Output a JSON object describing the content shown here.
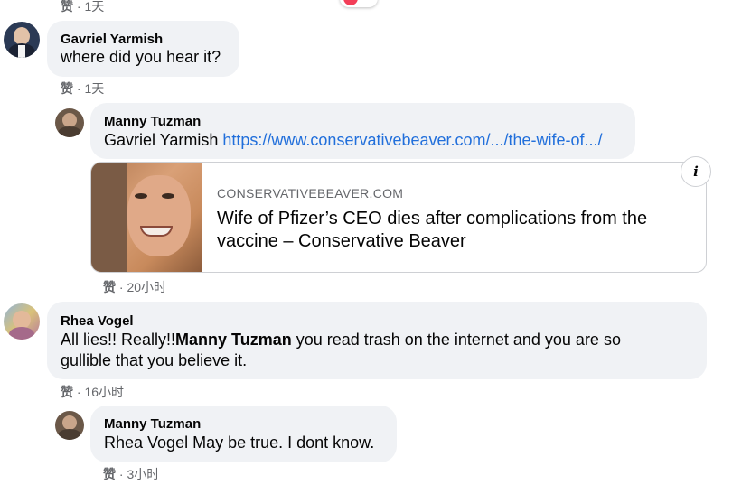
{
  "top": {
    "like_label": "赞",
    "time": "1天"
  },
  "comments": [
    {
      "author": "Gavriel Yarmish",
      "text": "where did you hear it?",
      "like_label": "赞",
      "time": "1天"
    },
    {
      "author": "Manny Tuzman",
      "mention": "Gavriel Yarmish",
      "link_text": "https://www.conservativebeaver.com/.../the-wife-of.../",
      "like_label": "赞",
      "time": "20小时",
      "preview": {
        "domain": "CONSERVATIVEBEAVER.COM",
        "title": "Wife of Pfizer’s CEO dies after complications from the vaccine – Conservative Beaver",
        "info_icon": "i"
      }
    },
    {
      "author": "Rhea Vogel",
      "text_before": "All lies!! Really!!",
      "mention": "Manny Tuzman",
      "text_after_line1": " you read trash on the internet and you are so",
      "text_line2": "gullible that you believe it.",
      "like_label": "赞",
      "time": "16小时"
    },
    {
      "author": "Manny Tuzman",
      "text": "Rhea Vogel May be true. I dont know.",
      "like_label": "赞",
      "time": "3小时"
    }
  ],
  "colors": {
    "bubble": "#f0f2f5",
    "link": "#216fdb",
    "meta": "#65676b",
    "reaction": "#f33e58"
  }
}
